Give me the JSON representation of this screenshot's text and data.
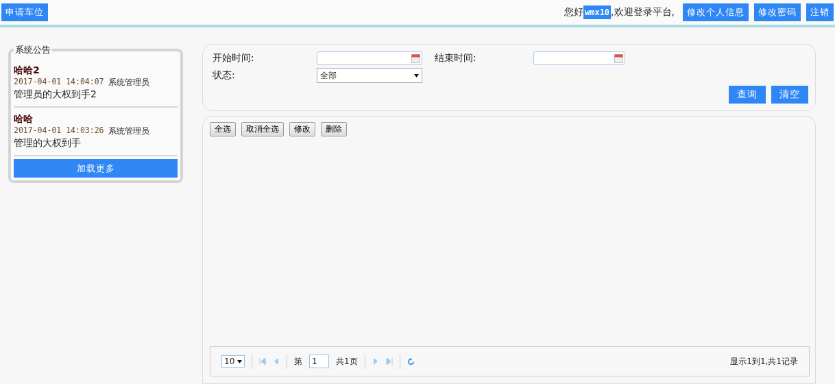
{
  "topbar": {
    "apply_button": "申请车位",
    "greeting_prefix": "您好",
    "username": "wmx10",
    "greeting_suffix": ",欢迎登录平台,",
    "buttons": [
      "修改个人信息",
      "修改密码",
      "注销"
    ]
  },
  "notices": {
    "title": "系统公告",
    "items": [
      {
        "title": "哈哈2",
        "time": "2017-04-01 14:04:07",
        "author": "系统管理员",
        "body": "管理员的大权到手2"
      },
      {
        "title": "哈哈",
        "time": "2017-04-01 14:03:26",
        "author": "系统管理员",
        "body": "管理的大权到手"
      }
    ],
    "more_button": "加载更多"
  },
  "filter": {
    "start_label": "开始时间:",
    "end_label": "结束时间:",
    "status_label": "状态:",
    "status_value": "全部",
    "buttons": [
      "查询",
      "清空"
    ]
  },
  "toolbar": [
    "全选",
    "取消全选",
    "修改",
    "删除"
  ],
  "pager": {
    "page_size": "10",
    "page_label": "第",
    "page_value": "1",
    "total_pages": "共1页",
    "summary": "显示1到1,共1记录"
  }
}
